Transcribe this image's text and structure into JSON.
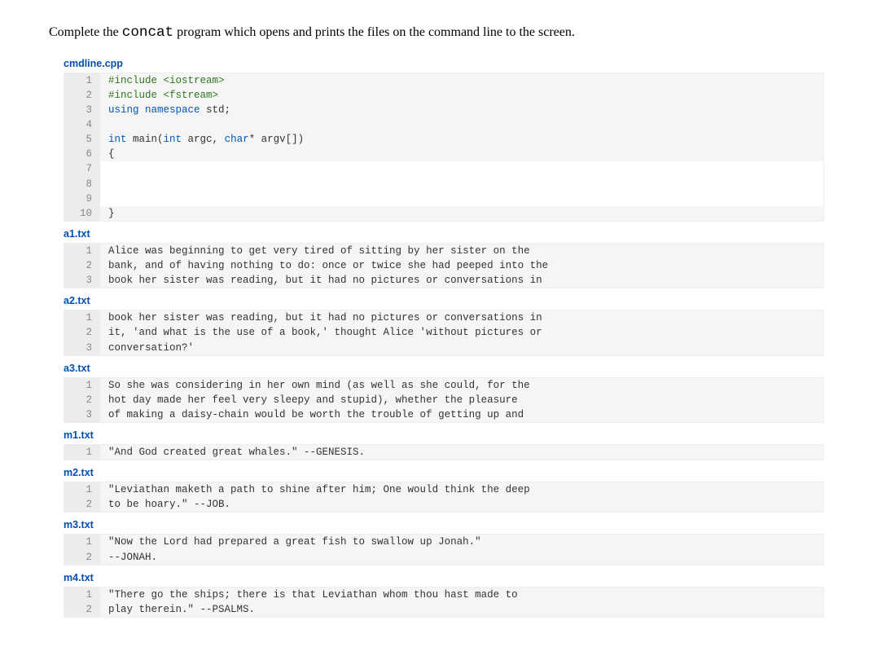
{
  "instruction_pre": "Complete the ",
  "instruction_code": "concat",
  "instruction_post": " program which opens and prints the files on the command line to the screen.",
  "files": [
    {
      "name": "cmdline.cpp",
      "lines": [
        {
          "n": "1",
          "html": "<span class='pp'>#include &lt;iostream&gt;</span>",
          "editable": false
        },
        {
          "n": "2",
          "html": "<span class='pp'>#include &lt;fstream&gt;</span>",
          "editable": false
        },
        {
          "n": "3",
          "html": "<span class='kw'>using</span> <span class='kw'>namespace</span> std;",
          "editable": false
        },
        {
          "n": "4",
          "html": "",
          "editable": false
        },
        {
          "n": "5",
          "html": "<span class='type'>int</span> main(<span class='type'>int</span> argc, <span class='type'>char</span>* argv[])",
          "editable": false
        },
        {
          "n": "6",
          "html": "{",
          "editable": false
        },
        {
          "n": "7",
          "html": "",
          "editable": true
        },
        {
          "n": "8",
          "html": "",
          "editable": true
        },
        {
          "n": "9",
          "html": "",
          "editable": true
        },
        {
          "n": "10",
          "html": "}",
          "editable": false
        }
      ]
    },
    {
      "name": "a1.txt",
      "lines": [
        {
          "n": "1",
          "text": "Alice was beginning to get very tired of sitting by her sister on the"
        },
        {
          "n": "2",
          "text": "bank, and of having nothing to do: once or twice she had peeped into the"
        },
        {
          "n": "3",
          "text": "book her sister was reading, but it had no pictures or conversations in"
        }
      ]
    },
    {
      "name": "a2.txt",
      "lines": [
        {
          "n": "1",
          "text": "book her sister was reading, but it had no pictures or conversations in"
        },
        {
          "n": "2",
          "text": "it, 'and what is the use of a book,' thought Alice 'without pictures or"
        },
        {
          "n": "3",
          "text": "conversation?'"
        }
      ]
    },
    {
      "name": "a3.txt",
      "lines": [
        {
          "n": "1",
          "text": "So she was considering in her own mind (as well as she could, for the"
        },
        {
          "n": "2",
          "text": "hot day made her feel very sleepy and stupid), whether the pleasure"
        },
        {
          "n": "3",
          "text": "of making a daisy-chain would be worth the trouble of getting up and"
        }
      ]
    },
    {
      "name": "m1.txt",
      "lines": [
        {
          "n": "1",
          "text": "\"And God created great whales.\" --GENESIS."
        }
      ]
    },
    {
      "name": "m2.txt",
      "lines": [
        {
          "n": "1",
          "text": "\"Leviathan maketh a path to shine after him; One would think the deep"
        },
        {
          "n": "2",
          "text": "to be hoary.\" --JOB."
        }
      ]
    },
    {
      "name": "m3.txt",
      "lines": [
        {
          "n": "1",
          "text": "\"Now the Lord had prepared a great fish to swallow up Jonah.\""
        },
        {
          "n": "2",
          "text": "--JONAH."
        }
      ]
    },
    {
      "name": "m4.txt",
      "lines": [
        {
          "n": "1",
          "text": "\"There go the ships; there is that Leviathan whom thou hast made to"
        },
        {
          "n": "2",
          "text": "play therein.\" --PSALMS."
        }
      ]
    }
  ]
}
